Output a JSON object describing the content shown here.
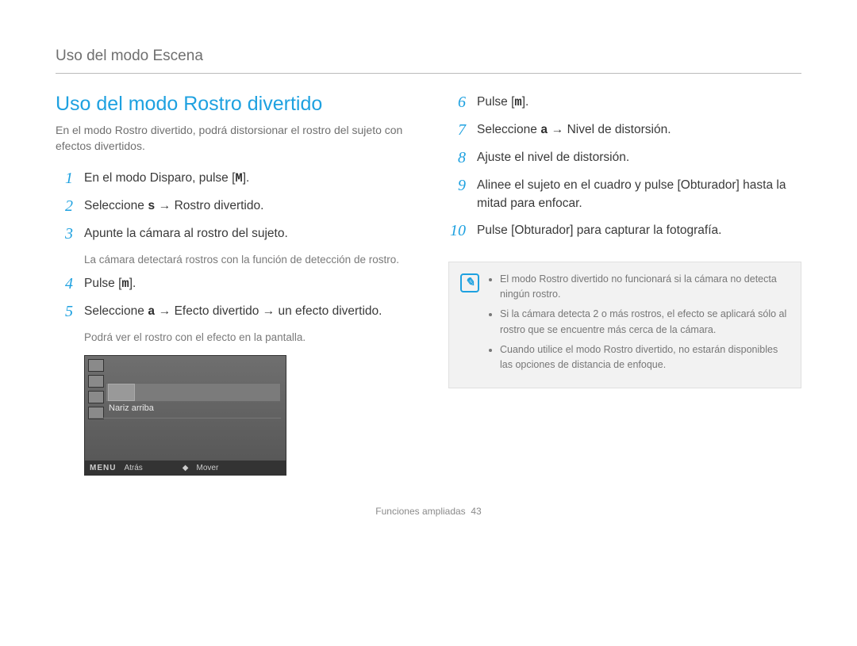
{
  "breadcrumb": "Uso del modo Escena",
  "title": "Uso del modo Rostro divertido",
  "intro": "En el modo Rostro divertido, podrá distorsionar el rostro del sujeto con efectos divertidos.",
  "left_steps": [
    {
      "n": "1",
      "text_before": "En el modo Disparo, pulse [",
      "bold": "M",
      "text_after": "]."
    },
    {
      "n": "2",
      "text_before": "Seleccione ",
      "bold": "s",
      "text_after": "  → Rostro divertido."
    },
    {
      "n": "3",
      "text_plain": "Apunte la cámara al rostro del sujeto."
    },
    {
      "n": "4",
      "text_before": "Pulse [",
      "bold": "m",
      "text_after": "]."
    },
    {
      "n": "5",
      "text_before": "Seleccione ",
      "bold": "a",
      "text_after": "  → Efecto divertido → un efecto divertido."
    }
  ],
  "indent_3": "La cámara detectará rostros con la función de detección de rostro.",
  "indent_5": "Podrá ver el rostro con el efecto en la pantalla.",
  "screen": {
    "label": "Nariz arriba",
    "menu": "MENU",
    "back": "Atrás",
    "move": "Mover"
  },
  "right_steps": [
    {
      "n": "6",
      "text_before": "Pulse [",
      "bold": "m",
      "text_after": "]."
    },
    {
      "n": "7",
      "text_before": "Seleccione ",
      "bold": "a",
      "text_after": "  → Nivel de distorsión."
    },
    {
      "n": "8",
      "text_plain": "Ajuste el nivel de distorsión."
    },
    {
      "n": "9",
      "text_plain": "Alinee el sujeto en el cuadro y pulse [Obturador] hasta la mitad para enfocar."
    },
    {
      "n": "10",
      "text_plain": "Pulse [Obturador] para capturar la fotografía."
    }
  ],
  "note_items": [
    "El modo Rostro divertido no funcionará si la cámara no detecta ningún rostro.",
    "Si la cámara detecta 2 o más rostros, el efecto se aplicará sólo al rostro que se encuentre más cerca de la cámara.",
    "Cuando utilice el modo Rostro divertido, no estarán disponibles las opciones de distancia de enfoque."
  ],
  "footer_section": "Funciones ampliadas",
  "footer_page": "43"
}
